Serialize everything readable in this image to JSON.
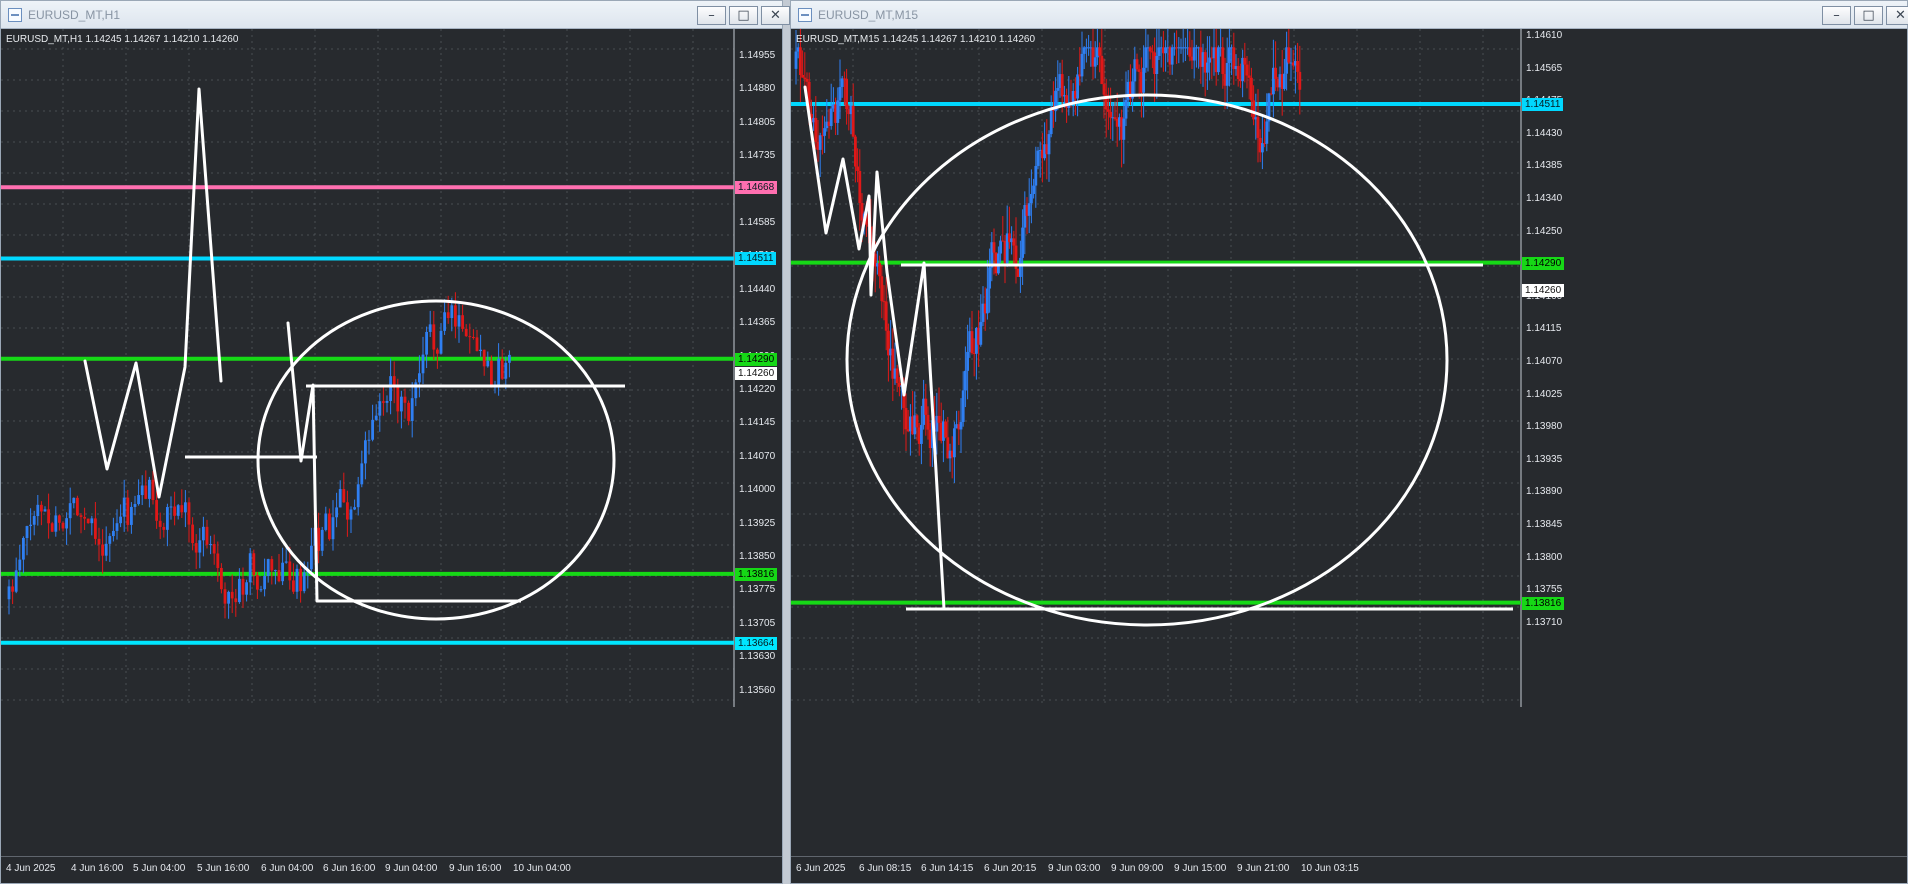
{
  "windows": [
    {
      "key": "h1",
      "title": "EURUSD_MT,H1",
      "info": "EURUSD_MT,H1  1.14245 1.14267 1.14210 1.14260",
      "buttons": [
        "minimize",
        "maximize",
        "close"
      ],
      "price_axis": [
        "1.14955",
        "1.14880",
        "1.14805",
        "1.14735",
        "1.14660",
        "1.14585",
        "1.14510",
        "1.14440",
        "1.14365",
        "1.14290",
        "1.14220",
        "1.14145",
        "1.14070",
        "1.14000",
        "1.13925",
        "1.13850",
        "1.13775",
        "1.13705",
        "1.13630",
        "1.13560"
      ],
      "time_axis": [
        "4 Jun 2025",
        "4 Jun 16:00",
        "5 Jun 04:00",
        "5 Jun 16:00",
        "6 Jun 04:00",
        "6 Jun 16:00",
        "9 Jun 04:00",
        "9 Jun 16:00",
        "10 Jun 04:00"
      ],
      "horizontal_levels": [
        {
          "label": "1.14668",
          "price": 1.14668,
          "color": "#ff6fb0"
        },
        {
          "label": "1.14511",
          "price": 1.14511,
          "color": "#00d8ff"
        },
        {
          "label": "1.14290",
          "price": 1.1429,
          "color": "#16d816"
        },
        {
          "label": "1.13816",
          "price": 1.13816,
          "color": "#16d816"
        },
        {
          "label": "1.13664",
          "price": 1.13664,
          "color": "#00e6ff"
        }
      ],
      "current_price": "1.14260",
      "colors": {
        "bull": "#2f7ff2",
        "bear": "#e01818",
        "grid": "#5b6168",
        "drawing": "#ffffff"
      }
    },
    {
      "key": "m15",
      "title": "EURUSD_MT,M15",
      "info": "EURUSD_MT,M15  1.14245 1.14267 1.14210 1.14260",
      "buttons": [
        "minimize",
        "maximize",
        "close"
      ],
      "price_axis": [
        "1.14610",
        "1.14565",
        "1.14475",
        "1.14430",
        "1.14385",
        "1.14340",
        "1.14250",
        "1.14205",
        "1.14160",
        "1.14115",
        "1.14070",
        "1.14025",
        "1.13980",
        "1.13935",
        "1.13890",
        "1.13845",
        "1.13800",
        "1.13755",
        "1.13710"
      ],
      "time_axis": [
        "6 Jun 2025",
        "6 Jun 08:15",
        "6 Jun 14:15",
        "6 Jun 20:15",
        "9 Jun 03:00",
        "9 Jun 09:00",
        "9 Jun 15:00",
        "9 Jun 21:00",
        "10 Jun 03:15"
      ],
      "horizontal_levels": [
        {
          "label": "1.14511",
          "price": 1.14511,
          "color": "#00d8ff"
        },
        {
          "label": "1.14290",
          "price": 1.1429,
          "color": "#16d816"
        },
        {
          "label": "1.13816",
          "price": 1.13816,
          "color": "#16d816"
        }
      ],
      "current_price": "1.14260",
      "colors": {
        "bull": "#2f7ff2",
        "bear": "#e01818",
        "grid": "#5b6168",
        "drawing": "#ffffff"
      }
    }
  ]
}
